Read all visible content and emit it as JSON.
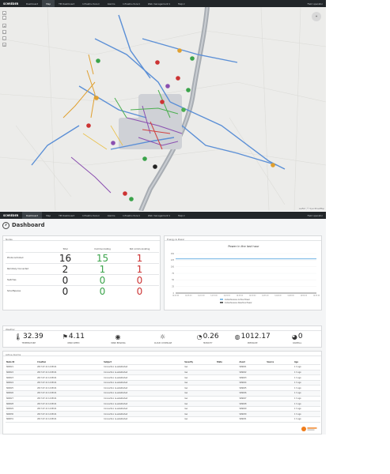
{
  "app": {
    "brand": "SCHRÉDER",
    "user_label": "Field operator"
  },
  "map_screen": {
    "nav": [
      {
        "label": "Dashboard"
      },
      {
        "label": "Map"
      },
      {
        "label": "TM Dashboard"
      },
      {
        "label": "Infrastructure ▾"
      },
      {
        "label": "Alarms"
      },
      {
        "label": "Infrastructure ▾"
      },
      {
        "label": "Web management ▾"
      },
      {
        "label": "Help ▾"
      }
    ],
    "attribution": "Leaflet | © OpenStreetMap"
  },
  "dashboard_screen": {
    "nav": [
      {
        "label": "Dashboard"
      },
      {
        "label": "Map"
      },
      {
        "label": "TM Dashboard"
      },
      {
        "label": "Infrastructure ▾"
      },
      {
        "label": "Alarms"
      },
      {
        "label": "Infrastructure ▾"
      },
      {
        "label": "Web management ▾"
      },
      {
        "label": "Help ▾"
      }
    ],
    "title": "Dashboard",
    "nodes_panel": {
      "title": "Nodes",
      "columns": [
        "Total",
        "Communicating",
        "Not communicating"
      ],
      "rows": [
        {
          "label": "Photocontrolled",
          "total": "16",
          "comm": "15",
          "noncomm": "1"
        },
        {
          "label": "Remotely Connected",
          "total": "2",
          "comm": "1",
          "noncomm": "1"
        },
        {
          "label": "Switches",
          "total": "0",
          "comm": "0",
          "noncomm": "0"
        },
        {
          "label": "SmartSpaces",
          "total": "0",
          "comm": "0",
          "noncomm": "0"
        }
      ]
    },
    "power_panel": {
      "panel_title": "Energy & Power",
      "chart_title": "Power in the last hour",
      "legend": [
        "Instantaneous Active Power",
        "Instantaneous Reactive Power"
      ]
    },
    "weather_panel": {
      "title": "Weather",
      "items": [
        {
          "icon": "thermometer-icon",
          "glyph": "🌡",
          "value": "32.39",
          "label": "TEMPERATURE"
        },
        {
          "icon": "wind-flag-icon",
          "glyph": "⚑",
          "value": "4.11",
          "label": "WIND SPEED"
        },
        {
          "icon": "wind-direction-icon",
          "glyph": "◉",
          "value": "",
          "label": "WIND BEARING"
        },
        {
          "icon": "sun-icon",
          "glyph": "☼",
          "value": "",
          "label": "CLOUD COVERAGE"
        },
        {
          "icon": "humidity-icon",
          "glyph": "◔",
          "value": "0.26",
          "label": "HUMIDITY"
        },
        {
          "icon": "pressure-icon",
          "glyph": "◍",
          "value": "1012.17",
          "label": "PRESSURE"
        },
        {
          "icon": "rain-icon",
          "glyph": "◕",
          "value": "0",
          "label": "RAINFALL"
        }
      ]
    },
    "alarms_panel": {
      "title": "Active Alarms",
      "columns": [
        "Node ID",
        "Creation",
        "Subject",
        "Severity",
        "State",
        "Asset",
        "Source",
        "Age"
      ],
      "rows": [
        [
          "SR9021",
          "2017-07-11 14:08:41",
          "Connection re-established",
          "low",
          "",
          "SR9021",
          "",
          "1 h ago"
        ],
        [
          "SR9022",
          "2017-07-11 14:08:41",
          "Connection re-established",
          "low",
          "",
          "SR9022",
          "",
          "1 h ago"
        ],
        [
          "SR9023",
          "2017-07-11 14:08:41",
          "Connection re-established",
          "low",
          "",
          "SR9023",
          "",
          "1 h ago"
        ],
        [
          "SR9024",
          "2017-07-11 14:08:41",
          "Connection re-established",
          "low",
          "",
          "SR9024",
          "",
          "1 h ago"
        ],
        [
          "SR9025",
          "2017-07-11 14:08:41",
          "Connection re-established",
          "low",
          "",
          "SR9025",
          "",
          "1 h ago"
        ],
        [
          "SR9026",
          "2017-07-11 14:08:41",
          "Connection re-established",
          "low",
          "",
          "SR9026",
          "",
          "1 h ago"
        ],
        [
          "SR9027",
          "2017-07-11 14:08:41",
          "Connection re-established",
          "low",
          "",
          "SR9027",
          "",
          "1 h ago"
        ],
        [
          "SR9028",
          "2017-07-11 14:08:41",
          "Connection re-established",
          "low",
          "",
          "SR9028",
          "",
          "1 h ago"
        ],
        [
          "SR9029",
          "2017-07-11 14:08:41",
          "Connection re-established",
          "low",
          "",
          "SR9029",
          "",
          "1 h ago"
        ],
        [
          "SR9030",
          "2017-07-11 14:08:41",
          "Connection re-established",
          "low",
          "",
          "SR9030",
          "",
          "1 h ago"
        ],
        [
          "SR9031",
          "2017-07-11 14:08:41",
          "Connection re-established",
          "low",
          "",
          "SR9031",
          "",
          "1 h ago"
        ]
      ]
    }
  },
  "chart_data": {
    "type": "line",
    "title": "Power in the last hour",
    "x": [
      "14:00:00",
      "14:05:00",
      "14:10:00",
      "14:15:00",
      "14:20:00",
      "14:25:00",
      "14:30:00",
      "14:35:00",
      "14:40:00",
      "14:45:00",
      "14:50:00",
      "14:55:00"
    ],
    "series": [
      {
        "name": "Instantaneous Active Power",
        "values": [
          130,
          130,
          130,
          130,
          130,
          130,
          130,
          130,
          130,
          130,
          130,
          130
        ],
        "color": "#5aa8e0"
      },
      {
        "name": "Instantaneous Reactive Power",
        "values": [
          0,
          0,
          0,
          0,
          0,
          0,
          0,
          0,
          0,
          0,
          0,
          0
        ],
        "color": "#333333"
      }
    ],
    "yticks": [
      "0",
      "25",
      "50",
      "75",
      "100",
      "125",
      "150"
    ],
    "ylim": [
      0,
      150
    ],
    "grid": true,
    "legend_position": "bottom"
  },
  "colors": {
    "navbar": "#222629",
    "communicating": "#3aa34a",
    "not_communicating": "#cc3333",
    "river": "#9aa0a8",
    "road_main": "#5b8fd6"
  }
}
